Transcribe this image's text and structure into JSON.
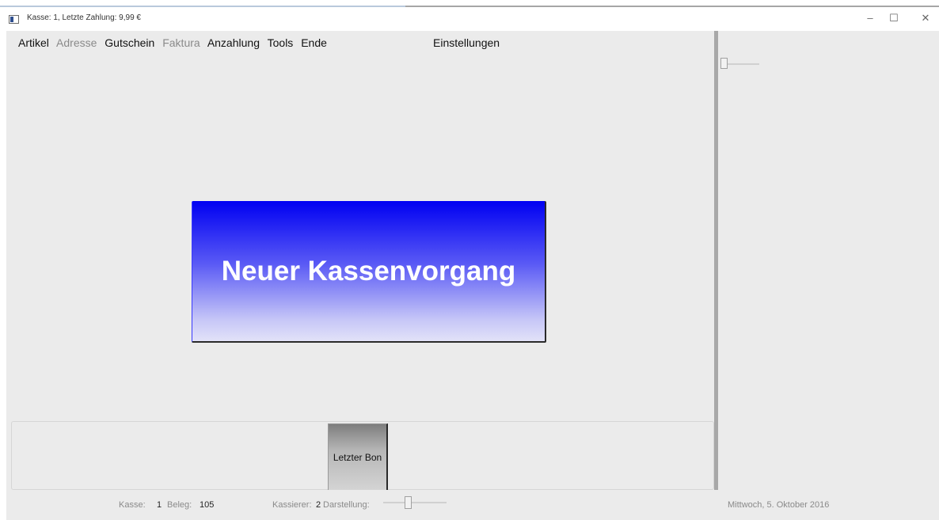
{
  "window": {
    "title": "Kasse: 1, Letzte Zahlung: 9,99 €",
    "controls": {
      "minimize": "–",
      "maximize": "☐",
      "close": "✕"
    }
  },
  "menu": {
    "items": [
      {
        "label": "Artikel",
        "enabled": true
      },
      {
        "label": "Adresse",
        "enabled": false
      },
      {
        "label": "Gutschein",
        "enabled": true
      },
      {
        "label": "Faktura",
        "enabled": false
      },
      {
        "label": "Anzahlung",
        "enabled": true
      },
      {
        "label": "Tools",
        "enabled": true
      },
      {
        "label": "Ende",
        "enabled": true
      }
    ],
    "settings": "Einstellungen"
  },
  "main": {
    "new_transaction_label": "Neuer Kassenvorgang",
    "last_receipt_label": "Letzter Bon"
  },
  "status": {
    "kasse_label": "Kasse:",
    "kasse_value": "1",
    "beleg_label": "Beleg:",
    "beleg_value": "105",
    "kassierer_label": "Kassierer:",
    "kassierer_value": "2",
    "darstellung_label": "Darstellung:",
    "date": "Mittwoch, 5. Oktober 2016"
  },
  "icons": [
    "app-icon",
    "minimize-icon",
    "maximize-icon",
    "close-icon"
  ],
  "colors": {
    "accent": "#0000f2",
    "background": "#ebebeb"
  }
}
